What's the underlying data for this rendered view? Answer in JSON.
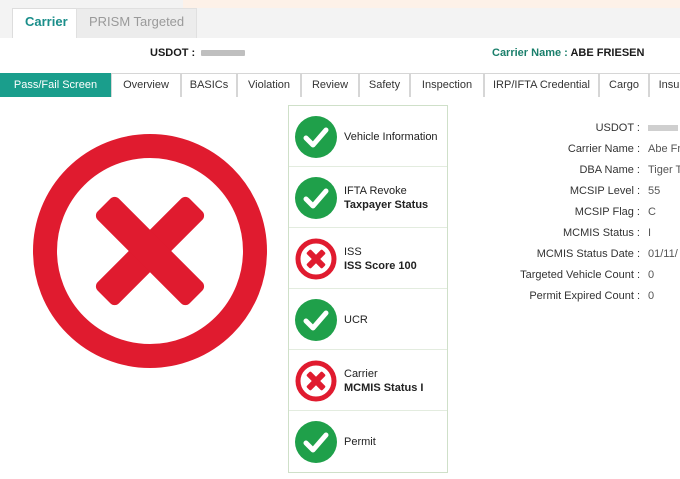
{
  "top_tabs": [
    {
      "label": "Carrier"
    },
    {
      "label": "PRISM Targeted"
    }
  ],
  "header": {
    "usdot_label": "USDOT :",
    "carrier_name_label": "Carrier Name :",
    "carrier_name_value": "ABE FRIESEN"
  },
  "nav_tabs": [
    {
      "label": "Pass/Fail Screen"
    },
    {
      "label": "Overview"
    },
    {
      "label": "BASICs"
    },
    {
      "label": "Violation"
    },
    {
      "label": "Review"
    },
    {
      "label": "Safety"
    },
    {
      "label": "Inspection"
    },
    {
      "label": "IRP/IFTA Credential"
    },
    {
      "label": "Cargo"
    },
    {
      "label": "Insu"
    }
  ],
  "overall_status": {
    "result": "fail",
    "icon": "fail-x-icon",
    "color": "#e01b2f"
  },
  "checks": [
    {
      "line1": "Vehicle Information",
      "line2": "",
      "status": "pass",
      "icon": "check-icon"
    },
    {
      "line1": "IFTA Revoke",
      "line2": "Taxpayer Status",
      "status": "pass",
      "icon": "check-icon"
    },
    {
      "line1": "ISS",
      "line2": "ISS Score 100",
      "status": "fail",
      "icon": "x-icon"
    },
    {
      "line1": "UCR",
      "line2": "",
      "status": "pass",
      "icon": "check-icon"
    },
    {
      "line1": "Carrier",
      "line2": "MCMIS Status I",
      "status": "fail",
      "icon": "x-icon"
    },
    {
      "line1": "Permit",
      "line2": "",
      "status": "pass",
      "icon": "check-icon"
    }
  ],
  "details": [
    {
      "label": "USDOT :",
      "value": ""
    },
    {
      "label": "Carrier Name :",
      "value": "Abe Fr"
    },
    {
      "label": "DBA Name :",
      "value": "Tiger T"
    },
    {
      "label": "MCSIP Level :",
      "value": "55"
    },
    {
      "label": "MCSIP Flag :",
      "value": "C"
    },
    {
      "label": "MCMIS Status :",
      "value": "I"
    },
    {
      "label": "MCMIS Status Date :",
      "value": "01/11/"
    },
    {
      "label": "Targeted Vehicle Count :",
      "value": "0"
    },
    {
      "label": "Permit Expired Count :",
      "value": "0"
    }
  ],
  "colors": {
    "accent": "#1a9e8c",
    "pass_green": "#1fa04a",
    "fail_red": "#e01b2f"
  }
}
